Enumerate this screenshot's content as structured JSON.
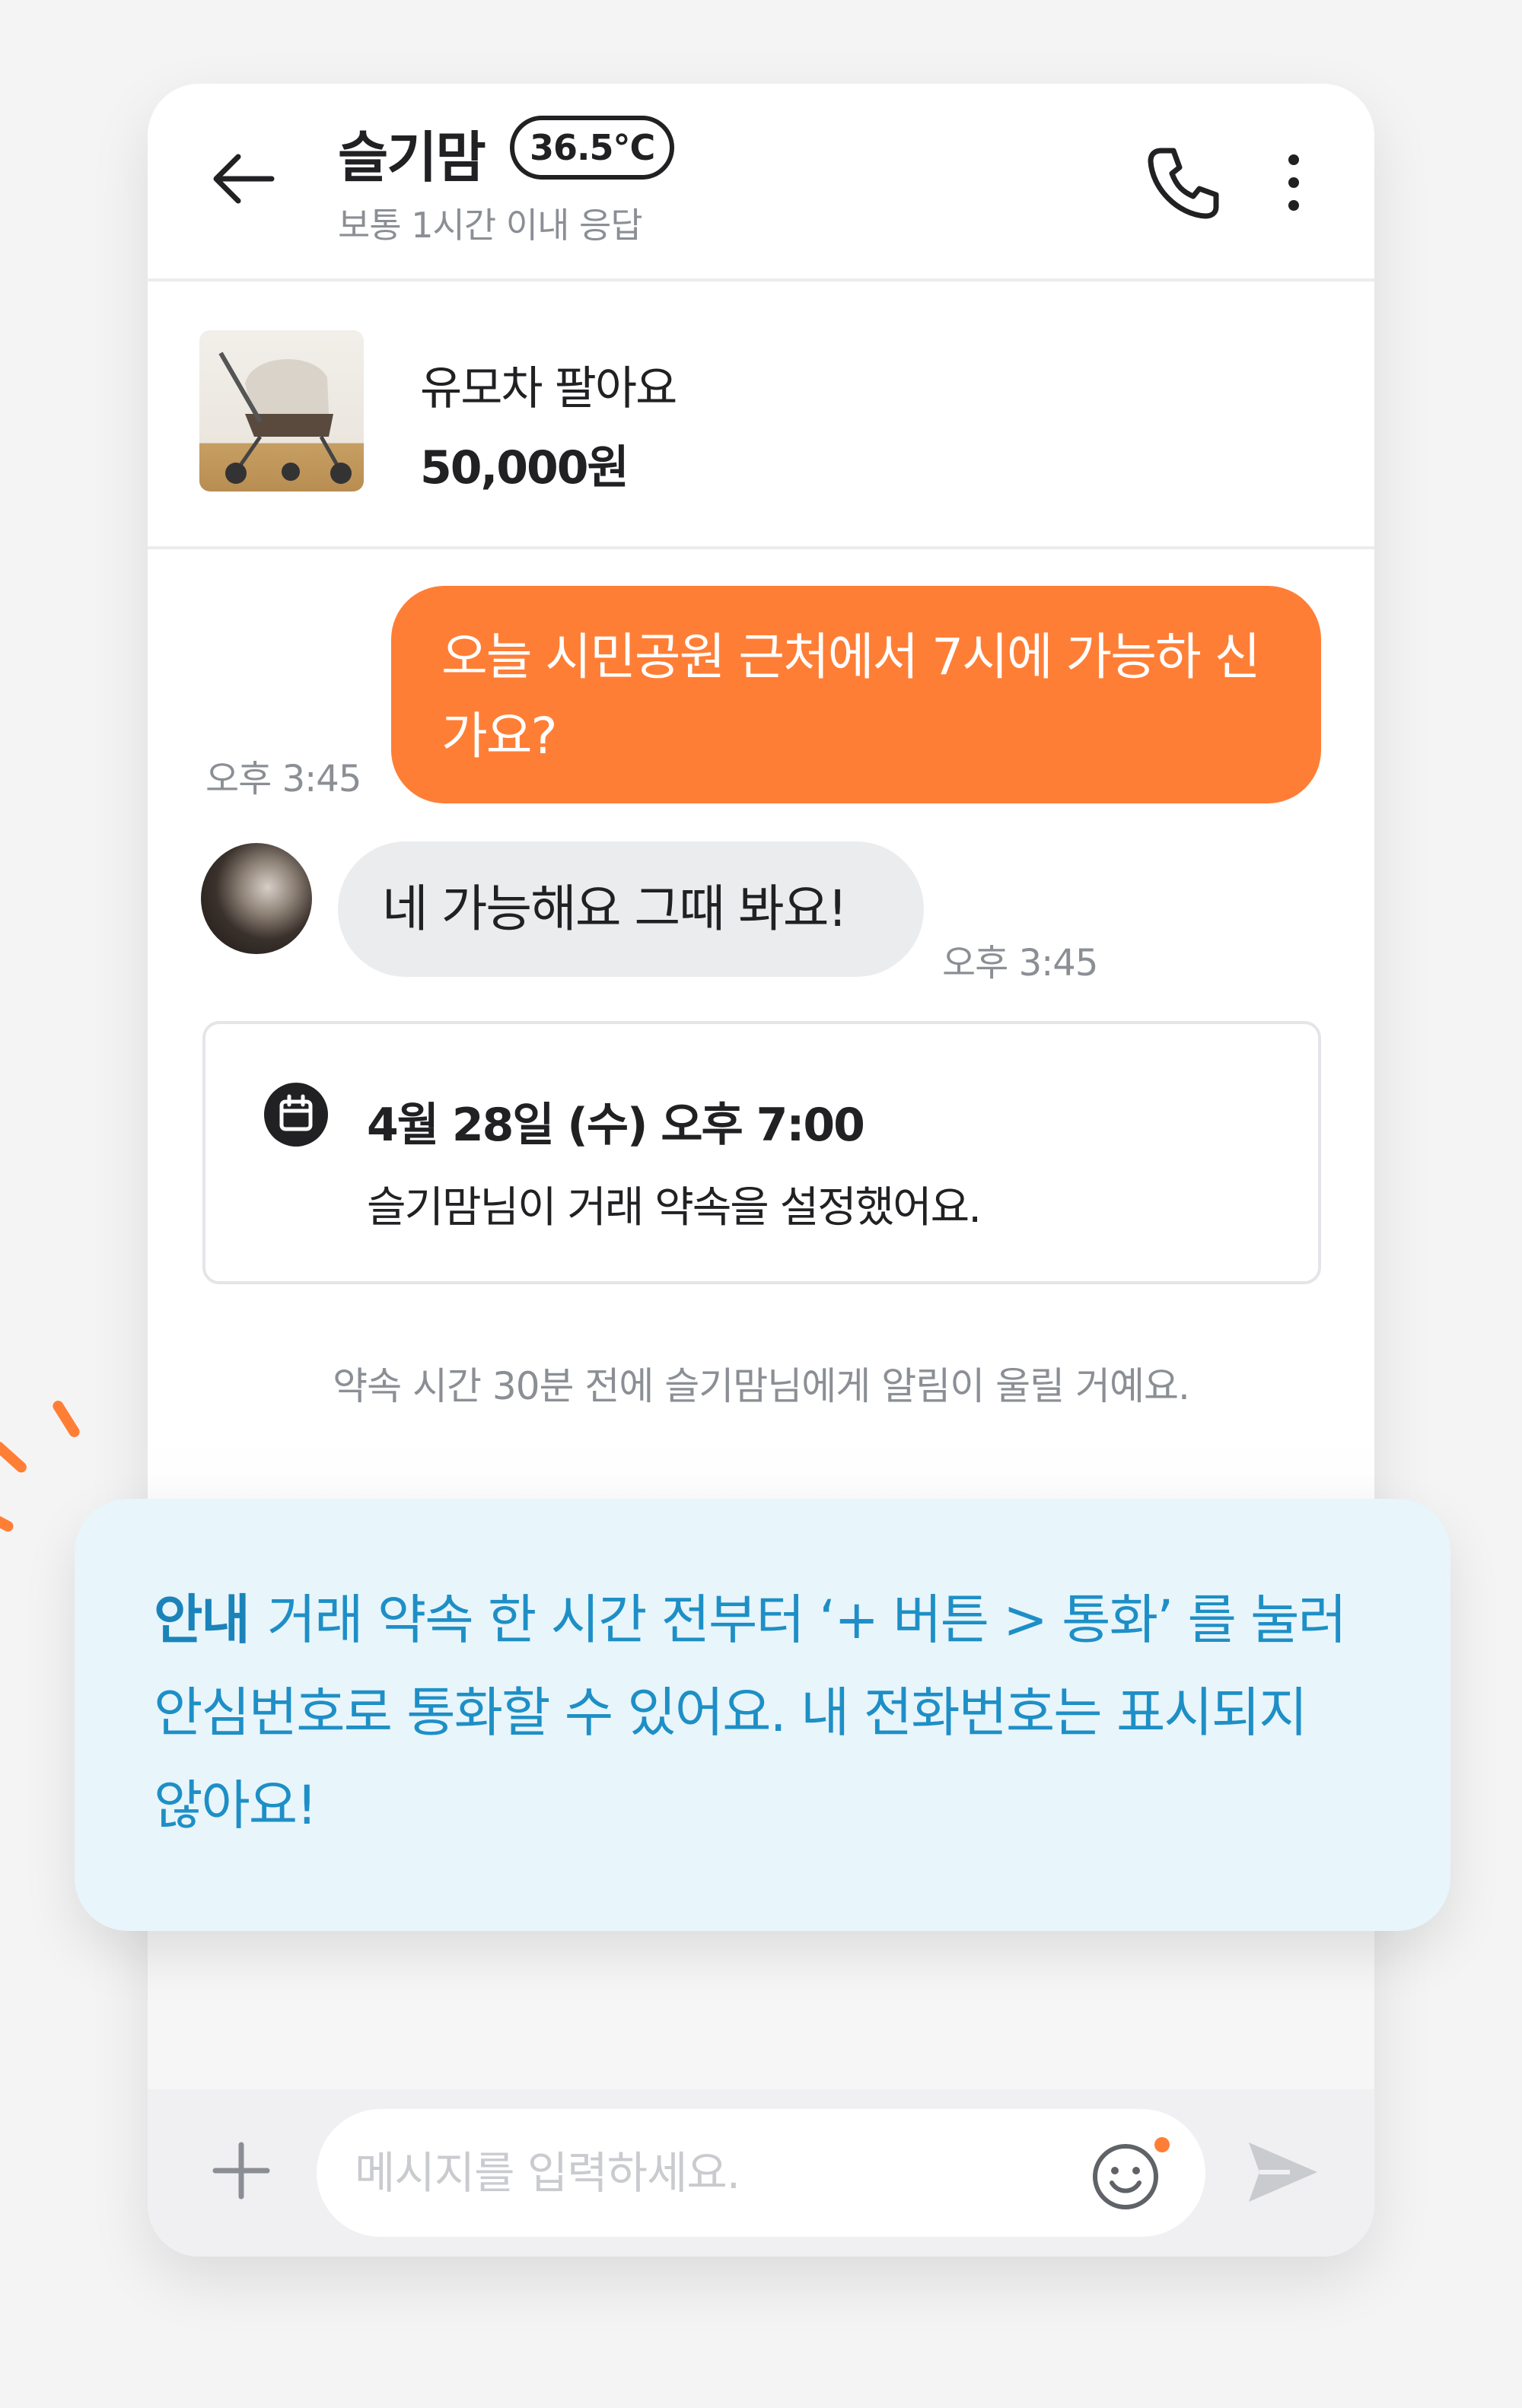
{
  "header": {
    "name": "슬기맘",
    "temperature": "36.5°C",
    "response_time": "보통 1시간 이내 응답",
    "back_icon": "arrow-left-icon",
    "call_icon": "phone-icon",
    "more_icon": "more-vertical-icon"
  },
  "product": {
    "title": "유모차 팔아요",
    "price": "50,000원",
    "thumbnail_icon": "stroller-image"
  },
  "messages": [
    {
      "direction": "outgoing",
      "text": "오늘 시민공원 근처에서 7시에 가능하 신가요?",
      "time": "오후 3:45"
    },
    {
      "direction": "incoming",
      "text": "네 가능해요 그때 봐요!",
      "time": "오후 3:45"
    }
  ],
  "appointment": {
    "icon": "calendar-icon",
    "datetime": "4월 28일 (수) 오후 7:00",
    "description": "슬기맘님이 거래 약속을 설정했어요."
  },
  "notice": "약속 시간 30분 전에 슬기맘님에게 알림이 울릴 거예요.",
  "guide": {
    "label": "안내",
    "text": "거래 약속 한 시간 전부터 ‘+ 버튼 > 통화’ 를 눌러 안심번호로 통화할 수 있어요. 내 전화번호는 표시되지 않아요!"
  },
  "input": {
    "placeholder": "메시지를 입력하세요.",
    "plus_icon": "plus-icon",
    "emoji_icon": "emoji-icon",
    "send_icon": "send-icon"
  },
  "colors": {
    "accent": "#ff7e36",
    "guide_text": "#1e8fc6",
    "guide_bg": "#e8f5fb"
  }
}
